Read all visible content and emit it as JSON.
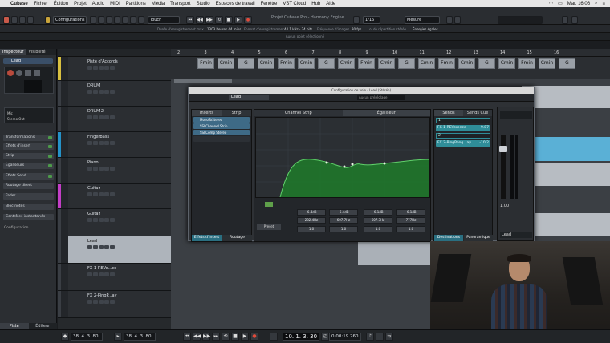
{
  "menubar": {
    "app": "Cubase",
    "items": [
      "Fichier",
      "Édition",
      "Projet",
      "Audio",
      "MIDI",
      "Partitions",
      "Média",
      "Transport",
      "Studio",
      "Espaces de travail",
      "Fenêtre",
      "VST Cloud",
      "Hub",
      "Aide"
    ],
    "clock": "Mar. 16:06"
  },
  "window": {
    "title": "Projet Cubase Pro - Harmony Engine"
  },
  "toolbar": {
    "config_label": "Configurations",
    "snap_mode": "Touch",
    "quantize": "Mesure",
    "grid": "1/16"
  },
  "infobar": {
    "record_time_label": "Durée d'enregistrement max.",
    "record_time": "1303 heures 44 mins",
    "record_format_label": "Format d'enregistrement",
    "record_format": "44.1 kHz - 24 bits",
    "frame_rate_label": "Fréquence d'images",
    "frame_rate": "30 fps",
    "pan_law_label": "Loi de répartition stéréo",
    "pan_law": "Énergies égales"
  },
  "selection_line": "Aucun objet sélectionné",
  "inspector": {
    "tabs": [
      "Inspecteur",
      "Visibilité"
    ],
    "track_name": "Lead",
    "sections": [
      "Transformations",
      "Effets d'insert",
      "Strip",
      "Égaliseurs",
      "Effets Send",
      "Routage direct",
      "Fader",
      "Bloc-notes",
      "Contrôles instantanés"
    ],
    "config_label": "Configuration",
    "insert_items": [
      "Mic",
      "Stereo Out"
    ],
    "bottom_tabs": [
      "Piste",
      "Éditeur"
    ]
  },
  "tracks": [
    {
      "name": "Piste d'Accords",
      "color": "#d8c040"
    },
    {
      "name": "DRUM",
      "color": "#3a3e44"
    },
    {
      "name": "DRUM 2",
      "color": "#3a3e44"
    },
    {
      "name": "FingerBass",
      "color": "#2592c8"
    },
    {
      "name": "Piano",
      "color": "#3a3e44"
    },
    {
      "name": "Guitar",
      "color": "#c23ec6"
    },
    {
      "name": "Guitar",
      "color": "#3a3e44"
    },
    {
      "name": "Lead",
      "color": "#3a3e44"
    },
    {
      "name": "FX 1-REVe...ce",
      "color": "#3a3e44"
    },
    {
      "name": "FX 2-PingP...ay",
      "color": "#3a3e44"
    }
  ],
  "ruler": {
    "bars": [
      "2",
      "3",
      "4",
      "5",
      "6",
      "7",
      "8",
      "9",
      "10",
      "11",
      "12",
      "13",
      "14",
      "15",
      "16"
    ]
  },
  "chords": [
    "Fmin",
    "Cmin",
    "G",
    "Cmin",
    "Fmin",
    "Cmin",
    "G",
    "Cmin",
    "Fmin",
    "Cmin",
    "G",
    "Cmin",
    "Fmin",
    "Cmin",
    "G",
    "Cmin",
    "Fmin",
    "Cmin",
    "G"
  ],
  "mixer": {
    "window_title": "Configuration de voie - Lead (Stéréo)",
    "channel": "Lead",
    "panel_inserts": "Inserts",
    "panel_strip": "Strip",
    "panel_channel_strip": "Channel Strip",
    "panel_eq": "Égaliseur",
    "panel_sends": "Sends",
    "panel_sends_cue": "Sends Cue",
    "inserts": [
      "MonoToStereo",
      "SSLChannel Strip",
      "SSLComp Stereo"
    ],
    "tabs_left": [
      "Effets d'insert",
      "Routage"
    ],
    "tabs_right": [
      "Destinations",
      "Panoramique"
    ],
    "preset_label": "Preset",
    "eq_bands": [
      {
        "gain": "-6.4dB",
        "freq": "282.4Hz",
        "q": "1.0"
      },
      {
        "gain": "-6.4dB",
        "freq": "607.7Hz",
        "q": "1.0"
      },
      {
        "gain": "-6.1dB",
        "freq": "607.7Hz",
        "q": "1.0"
      },
      {
        "gain": "-6.1dB",
        "freq": "777Hz",
        "q": "1.0"
      }
    ],
    "sends": [
      {
        "slot": "1",
        "dest": "FX 1-REVerence",
        "level": "-9.87"
      },
      {
        "slot": "2",
        "dest": "FX 2-PingPong...ay",
        "level": "-10.2"
      }
    ],
    "fader_value": "1.00",
    "fader_label": "Lead",
    "automation_label": "Aucun préréglage"
  },
  "transport": {
    "left_locator": "38. 4. 3. 80",
    "right_locator": "38. 4. 3. 80",
    "position": "10. 1. 3. 30",
    "time": "0:00:19.260"
  }
}
